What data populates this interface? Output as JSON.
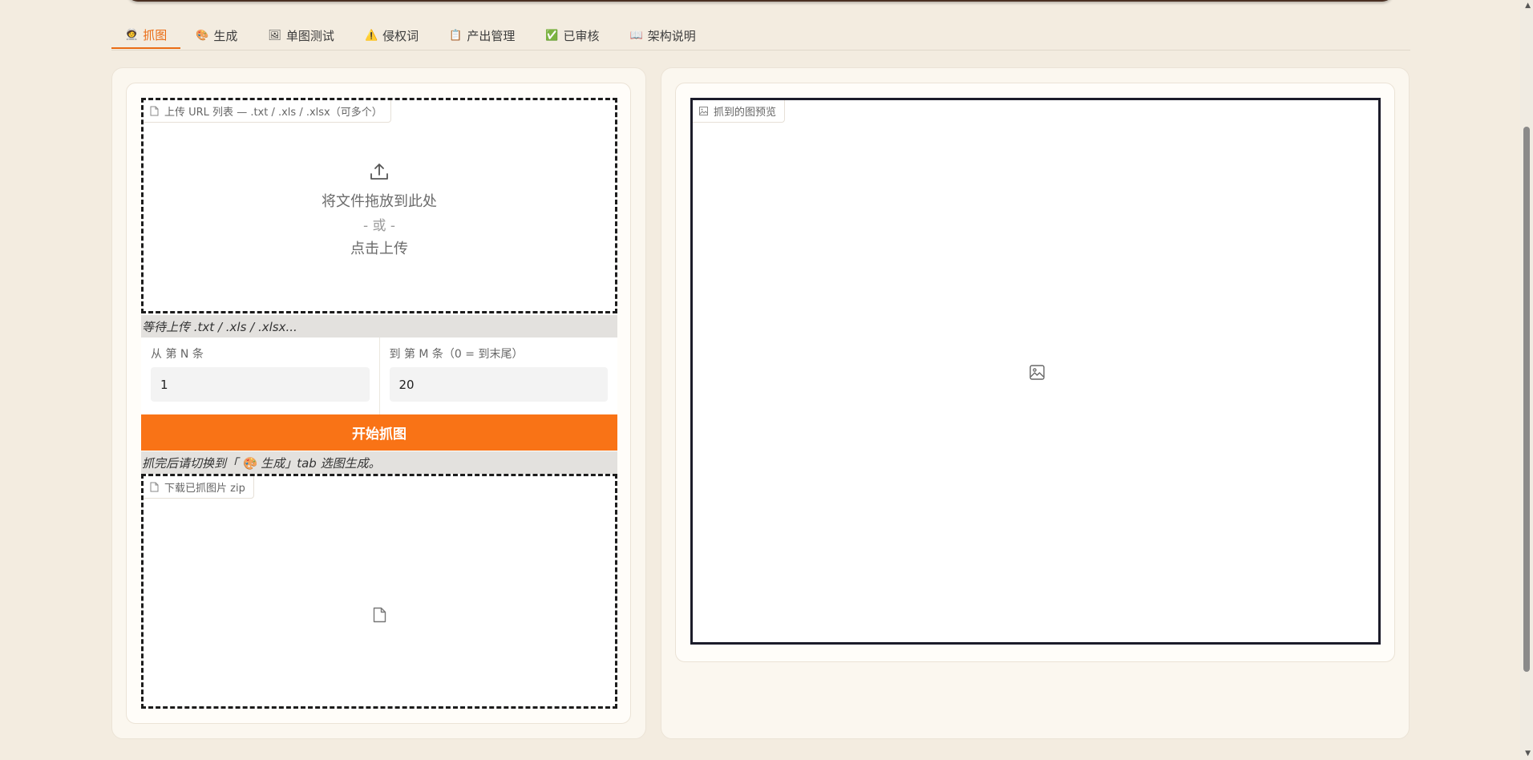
{
  "tabs": [
    {
      "label": "抓图",
      "icon": "🧑‍🚀",
      "active": true
    },
    {
      "label": "生成",
      "icon": "🎨"
    },
    {
      "label": "单图测试",
      "icon": "🖼"
    },
    {
      "label": "侵权词",
      "icon": "⚠️"
    },
    {
      "label": "产出管理",
      "icon": "📋"
    },
    {
      "label": "已审核",
      "icon": "✅"
    },
    {
      "label": "架构说明",
      "icon": "📖"
    }
  ],
  "upload": {
    "chip_label": "上传 URL 列表 — .txt / .xls / .xlsx（可多个）",
    "drop_text": "将文件拖放到此处",
    "or_text": "- 或 -",
    "click_text": "点击上传"
  },
  "upload_status": "等待上传 .txt / .xls / .xlsx...",
  "range": {
    "from_label": "从 第 N 条",
    "from_value": "1",
    "to_label": "到 第 M 条（0 = 到末尾）",
    "to_value": "20"
  },
  "start_button": "开始抓图",
  "hint": "抓完后请切换到「 🎨 生成」tab 选图生成。",
  "download": {
    "chip_label": "下载已抓图片 zip"
  },
  "preview": {
    "chip_label": "抓到的图预览"
  },
  "colors": {
    "accent": "#f97316",
    "tab_active": "#ea6c14",
    "background": "#f3ece0"
  }
}
